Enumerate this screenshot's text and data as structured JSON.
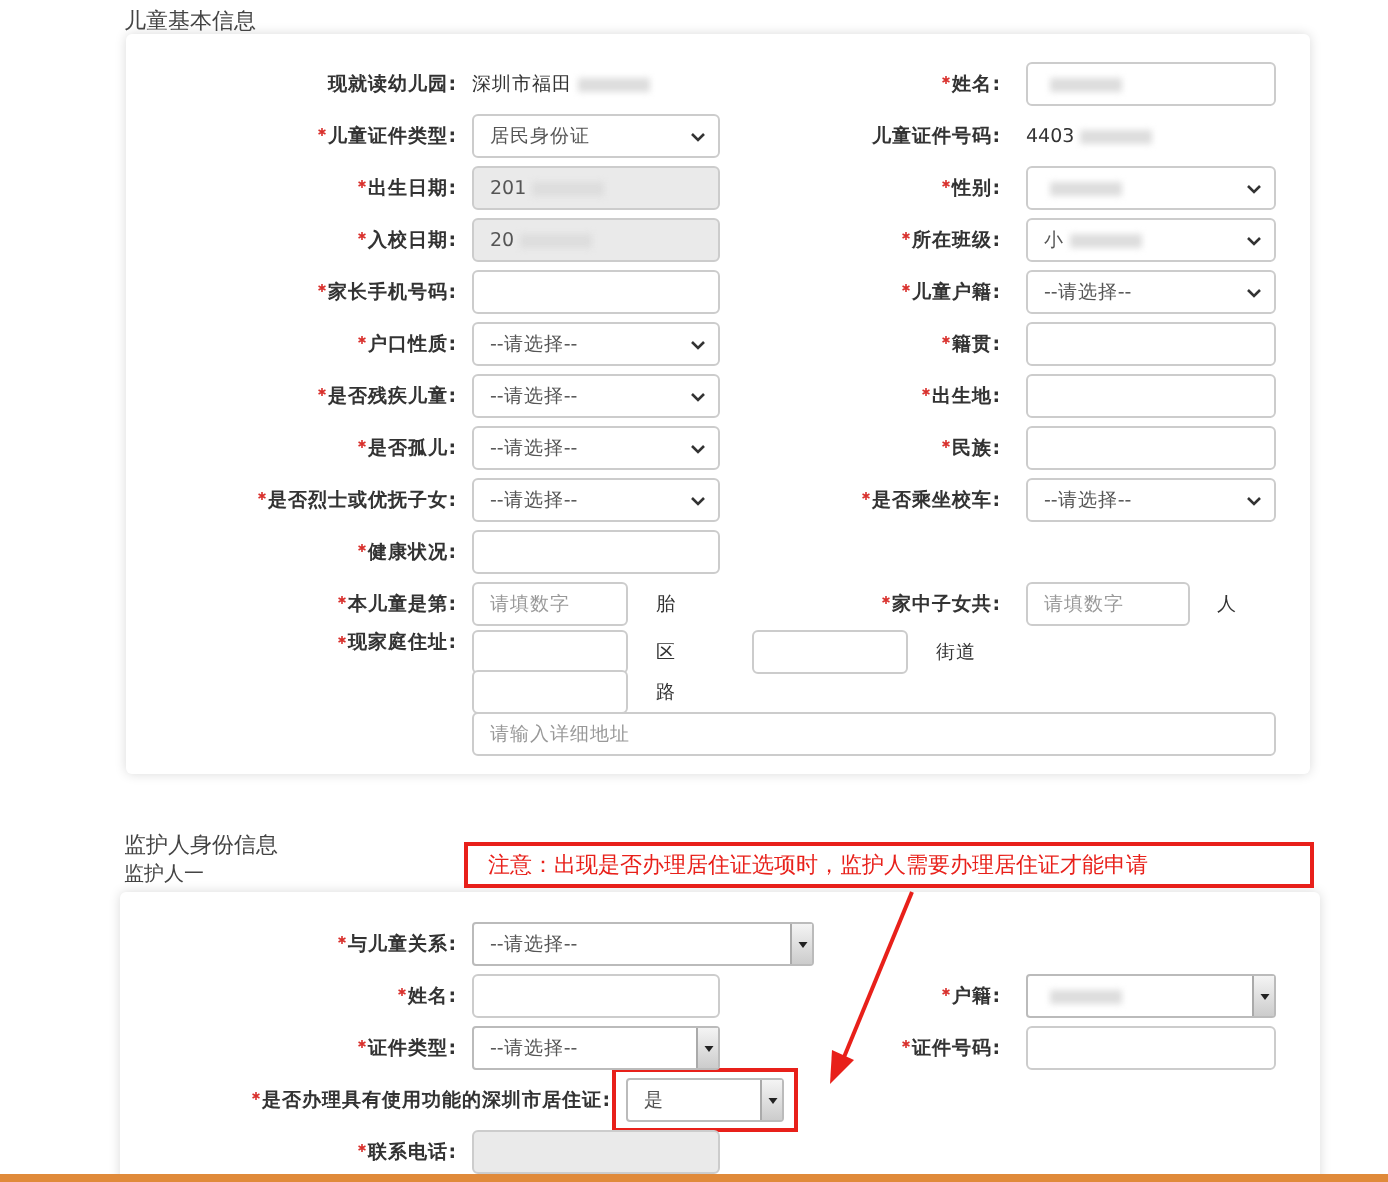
{
  "child_section": {
    "title": "儿童基本信息",
    "rows": [
      [
        {
          "label": "现就读幼儿园:",
          "required": false,
          "kind": "text",
          "value": "深圳市福田",
          "masked": true
        },
        {
          "label": "姓名:",
          "required": true,
          "kind": "input",
          "masked": true
        }
      ],
      [
        {
          "label": "儿童证件类型:",
          "required": true,
          "kind": "select",
          "value": "居民身份证"
        },
        {
          "label": "儿童证件号码:",
          "required": false,
          "kind": "text",
          "value": "4403",
          "masked": true
        }
      ],
      [
        {
          "label": "出生日期:",
          "required": true,
          "kind": "input",
          "value": "201",
          "masked": true,
          "disabled": true
        },
        {
          "label": "性别:",
          "required": true,
          "kind": "select",
          "masked": true
        }
      ],
      [
        {
          "label": "入校日期:",
          "required": true,
          "kind": "input",
          "value": "20",
          "masked": true,
          "disabled": true
        },
        {
          "label": "所在班级:",
          "required": true,
          "kind": "select",
          "value": "小",
          "masked": true
        }
      ],
      [
        {
          "label": "家长手机号码:",
          "required": true,
          "kind": "input"
        },
        {
          "label": "儿童户籍:",
          "required": true,
          "kind": "select",
          "value": "--请选择--"
        }
      ],
      [
        {
          "label": "户口性质:",
          "required": true,
          "kind": "select",
          "value": "--请选择--"
        },
        {
          "label": "籍贯:",
          "required": true,
          "kind": "input"
        }
      ],
      [
        {
          "label": "是否残疾儿童:",
          "required": true,
          "kind": "select",
          "value": "--请选择--"
        },
        {
          "label": "出生地:",
          "required": true,
          "kind": "input"
        }
      ],
      [
        {
          "label": "是否孤儿:",
          "required": true,
          "kind": "select",
          "value": "--请选择--"
        },
        {
          "label": "民族:",
          "required": true,
          "kind": "input"
        }
      ],
      [
        {
          "label": "是否烈士或优抚子女:",
          "required": true,
          "kind": "select",
          "value": "--请选择--"
        },
        {
          "label": "是否乘坐校车:",
          "required": true,
          "kind": "select",
          "value": "--请选择--"
        }
      ],
      [
        {
          "label": "健康状况:",
          "required": true,
          "kind": "input"
        }
      ],
      [
        {
          "label": "本儿童是第:",
          "required": true,
          "kind": "number",
          "placeholder": "请填数字",
          "unit": "胎"
        },
        {
          "label": "家中子女共:",
          "required": true,
          "kind": "number",
          "placeholder": "请填数字",
          "unit": "人"
        }
      ],
      [
        {
          "label": "现家庭住址:",
          "required": true,
          "kind": "address",
          "district_unit": "区",
          "street_unit": "街道",
          "road_unit": "路",
          "detail_placeholder": "请输入详细地址"
        }
      ]
    ]
  },
  "guardian_section": {
    "title": "监护人身份信息",
    "subtitle": "监护人一",
    "rows": [
      [
        {
          "label": "与儿童关系:",
          "required": true,
          "kind": "dropdown",
          "value": "--请选择--",
          "wide_field": true
        }
      ],
      [
        {
          "label": "姓名:",
          "required": true,
          "kind": "input"
        },
        {
          "label": "户籍:",
          "required": true,
          "kind": "dropdown",
          "masked": true
        }
      ],
      [
        {
          "label": "证件类型:",
          "required": true,
          "kind": "dropdown",
          "value": "--请选择--"
        },
        {
          "label": "证件号码:",
          "required": true,
          "kind": "input"
        }
      ],
      [
        {
          "label": "是否办理具有使用功能的深圳市居住证:",
          "required": true,
          "kind": "dropdown",
          "value": "是",
          "long_label": true,
          "highlighted": true
        }
      ],
      [
        {
          "label": "联系电话:",
          "required": true,
          "kind": "input",
          "disabled": true
        }
      ]
    ]
  },
  "annotation": {
    "text": "注意：出现是否办理居住证选项时，监护人需要办理居住证才能申请"
  }
}
